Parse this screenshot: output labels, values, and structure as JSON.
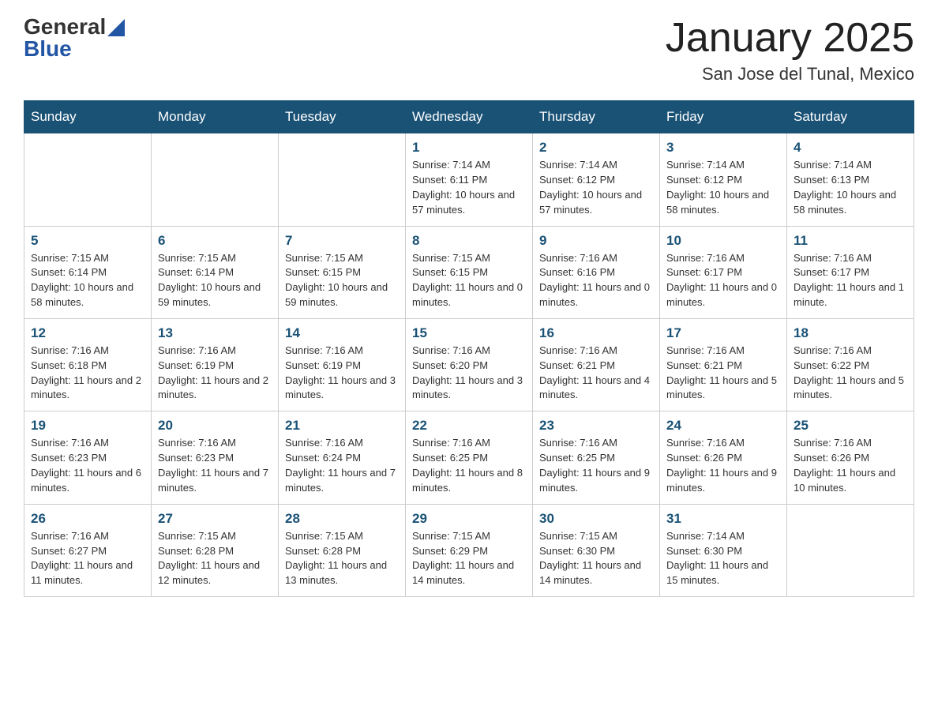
{
  "header": {
    "logo": {
      "general": "General",
      "blue": "Blue"
    },
    "title": "January 2025",
    "subtitle": "San Jose del Tunal, Mexico"
  },
  "days_of_week": [
    "Sunday",
    "Monday",
    "Tuesday",
    "Wednesday",
    "Thursday",
    "Friday",
    "Saturday"
  ],
  "weeks": [
    [
      {
        "day": "",
        "info": ""
      },
      {
        "day": "",
        "info": ""
      },
      {
        "day": "",
        "info": ""
      },
      {
        "day": "1",
        "info": "Sunrise: 7:14 AM\nSunset: 6:11 PM\nDaylight: 10 hours and 57 minutes."
      },
      {
        "day": "2",
        "info": "Sunrise: 7:14 AM\nSunset: 6:12 PM\nDaylight: 10 hours and 57 minutes."
      },
      {
        "day": "3",
        "info": "Sunrise: 7:14 AM\nSunset: 6:12 PM\nDaylight: 10 hours and 58 minutes."
      },
      {
        "day": "4",
        "info": "Sunrise: 7:14 AM\nSunset: 6:13 PM\nDaylight: 10 hours and 58 minutes."
      }
    ],
    [
      {
        "day": "5",
        "info": "Sunrise: 7:15 AM\nSunset: 6:14 PM\nDaylight: 10 hours and 58 minutes."
      },
      {
        "day": "6",
        "info": "Sunrise: 7:15 AM\nSunset: 6:14 PM\nDaylight: 10 hours and 59 minutes."
      },
      {
        "day": "7",
        "info": "Sunrise: 7:15 AM\nSunset: 6:15 PM\nDaylight: 10 hours and 59 minutes."
      },
      {
        "day": "8",
        "info": "Sunrise: 7:15 AM\nSunset: 6:15 PM\nDaylight: 11 hours and 0 minutes."
      },
      {
        "day": "9",
        "info": "Sunrise: 7:16 AM\nSunset: 6:16 PM\nDaylight: 11 hours and 0 minutes."
      },
      {
        "day": "10",
        "info": "Sunrise: 7:16 AM\nSunset: 6:17 PM\nDaylight: 11 hours and 0 minutes."
      },
      {
        "day": "11",
        "info": "Sunrise: 7:16 AM\nSunset: 6:17 PM\nDaylight: 11 hours and 1 minute."
      }
    ],
    [
      {
        "day": "12",
        "info": "Sunrise: 7:16 AM\nSunset: 6:18 PM\nDaylight: 11 hours and 2 minutes."
      },
      {
        "day": "13",
        "info": "Sunrise: 7:16 AM\nSunset: 6:19 PM\nDaylight: 11 hours and 2 minutes."
      },
      {
        "day": "14",
        "info": "Sunrise: 7:16 AM\nSunset: 6:19 PM\nDaylight: 11 hours and 3 minutes."
      },
      {
        "day": "15",
        "info": "Sunrise: 7:16 AM\nSunset: 6:20 PM\nDaylight: 11 hours and 3 minutes."
      },
      {
        "day": "16",
        "info": "Sunrise: 7:16 AM\nSunset: 6:21 PM\nDaylight: 11 hours and 4 minutes."
      },
      {
        "day": "17",
        "info": "Sunrise: 7:16 AM\nSunset: 6:21 PM\nDaylight: 11 hours and 5 minutes."
      },
      {
        "day": "18",
        "info": "Sunrise: 7:16 AM\nSunset: 6:22 PM\nDaylight: 11 hours and 5 minutes."
      }
    ],
    [
      {
        "day": "19",
        "info": "Sunrise: 7:16 AM\nSunset: 6:23 PM\nDaylight: 11 hours and 6 minutes."
      },
      {
        "day": "20",
        "info": "Sunrise: 7:16 AM\nSunset: 6:23 PM\nDaylight: 11 hours and 7 minutes."
      },
      {
        "day": "21",
        "info": "Sunrise: 7:16 AM\nSunset: 6:24 PM\nDaylight: 11 hours and 7 minutes."
      },
      {
        "day": "22",
        "info": "Sunrise: 7:16 AM\nSunset: 6:25 PM\nDaylight: 11 hours and 8 minutes."
      },
      {
        "day": "23",
        "info": "Sunrise: 7:16 AM\nSunset: 6:25 PM\nDaylight: 11 hours and 9 minutes."
      },
      {
        "day": "24",
        "info": "Sunrise: 7:16 AM\nSunset: 6:26 PM\nDaylight: 11 hours and 9 minutes."
      },
      {
        "day": "25",
        "info": "Sunrise: 7:16 AM\nSunset: 6:26 PM\nDaylight: 11 hours and 10 minutes."
      }
    ],
    [
      {
        "day": "26",
        "info": "Sunrise: 7:16 AM\nSunset: 6:27 PM\nDaylight: 11 hours and 11 minutes."
      },
      {
        "day": "27",
        "info": "Sunrise: 7:15 AM\nSunset: 6:28 PM\nDaylight: 11 hours and 12 minutes."
      },
      {
        "day": "28",
        "info": "Sunrise: 7:15 AM\nSunset: 6:28 PM\nDaylight: 11 hours and 13 minutes."
      },
      {
        "day": "29",
        "info": "Sunrise: 7:15 AM\nSunset: 6:29 PM\nDaylight: 11 hours and 14 minutes."
      },
      {
        "day": "30",
        "info": "Sunrise: 7:15 AM\nSunset: 6:30 PM\nDaylight: 11 hours and 14 minutes."
      },
      {
        "day": "31",
        "info": "Sunrise: 7:14 AM\nSunset: 6:30 PM\nDaylight: 11 hours and 15 minutes."
      },
      {
        "day": "",
        "info": ""
      }
    ]
  ]
}
